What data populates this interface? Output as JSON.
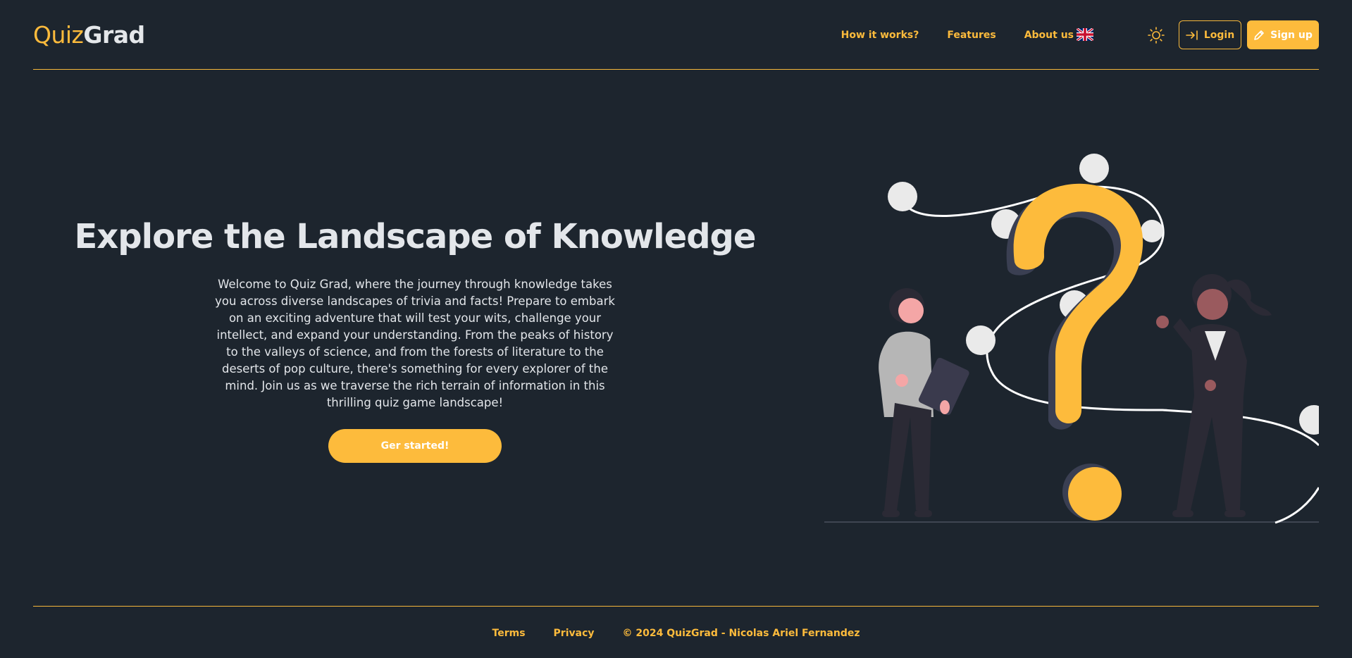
{
  "header": {
    "logo_part1": "Quiz",
    "logo_part2": "Grad",
    "nav": [
      "How it works?",
      "Features",
      "About us"
    ],
    "language_icon": "uk-flag-icon",
    "theme_icon": "sun-icon",
    "login_label": "Login",
    "signup_label": "Sign up"
  },
  "hero": {
    "title": "Explore the Landscape of Knowledge",
    "description": "Welcome to Quiz Grad, where the journey through knowledge takes you across diverse landscapes of trivia and facts! Prepare to embark on an exciting adventure that will test your wits, challenge your intellect, and expand your understanding. From the peaks of history to the valleys of science, and from the forests of literature to the deserts of pop culture, there's something for every explorer of the mind. Join us as we traverse the rich terrain of information in this thrilling quiz game landscape!",
    "cta_label": "Ger started!"
  },
  "footer": {
    "terms": "Terms",
    "privacy": "Privacy",
    "copyright": "© 2024 QuizGrad - Nicolas Ariel Fernandez"
  },
  "colors": {
    "background": "#1d252e",
    "accent": "#fdbb3c",
    "text": "#e3e6ea"
  }
}
